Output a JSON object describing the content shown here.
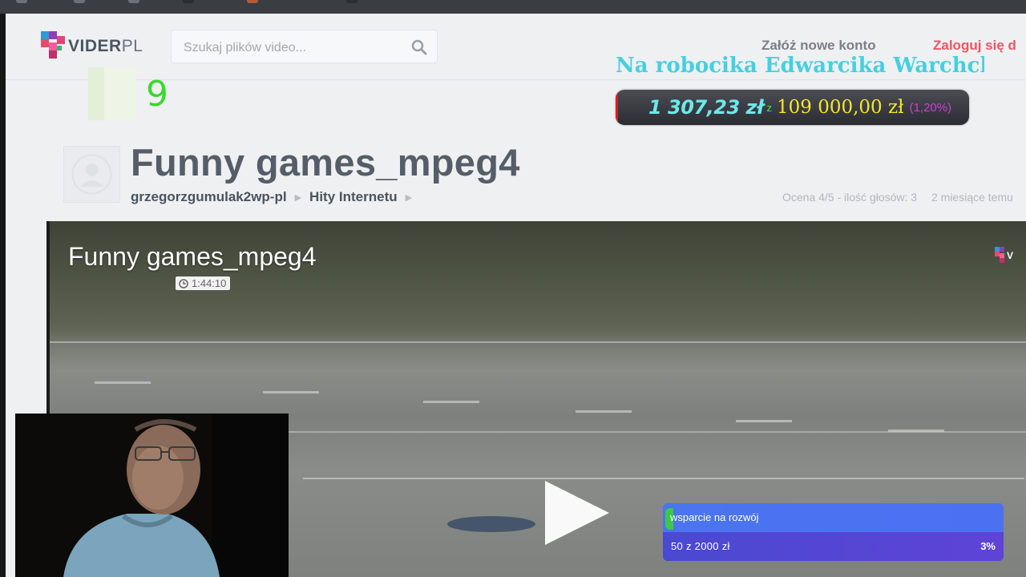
{
  "header": {
    "logo_text_main": "VIDER",
    "logo_text_suffix": "PL",
    "search_placeholder": "Szukaj plików video...",
    "register_label": "Załóż nowe konto",
    "login_label": "Zaloguj się d"
  },
  "overlay": {
    "ticker_text": "Na robocika Edwarcika Warchcki",
    "donation_raised": "1 307,23 zł",
    "donation_separator": "z",
    "donation_goal": "109 000,00 zł",
    "donation_percent": "(1,20%)",
    "k9_text": "9"
  },
  "video_page": {
    "title": "Funny games_mpeg4",
    "breadcrumb": [
      "grzegorzgumulak2wp-pl",
      "Hity Internetu"
    ],
    "rating": "Ocena 4/5 - ilość głosów: 3",
    "posted": "2 miesiące temu"
  },
  "player": {
    "title": "Funny games_mpeg4",
    "duration": "1:44:10"
  },
  "support_widget": {
    "label": "wsparcie na rozwój",
    "amount": "50 z 2000 zł",
    "percent": "3%",
    "progress": 0.025
  },
  "colors": {
    "brand_red": "#ee5561",
    "ticker_cyan": "#46cfe0",
    "goal_yellow": "#f3e62a",
    "support_blue": "#4a74f0"
  },
  "icons": [
    "search-icon",
    "clock-icon",
    "play-icon",
    "user-placeholder-icon",
    "vider-logo-icon"
  ]
}
